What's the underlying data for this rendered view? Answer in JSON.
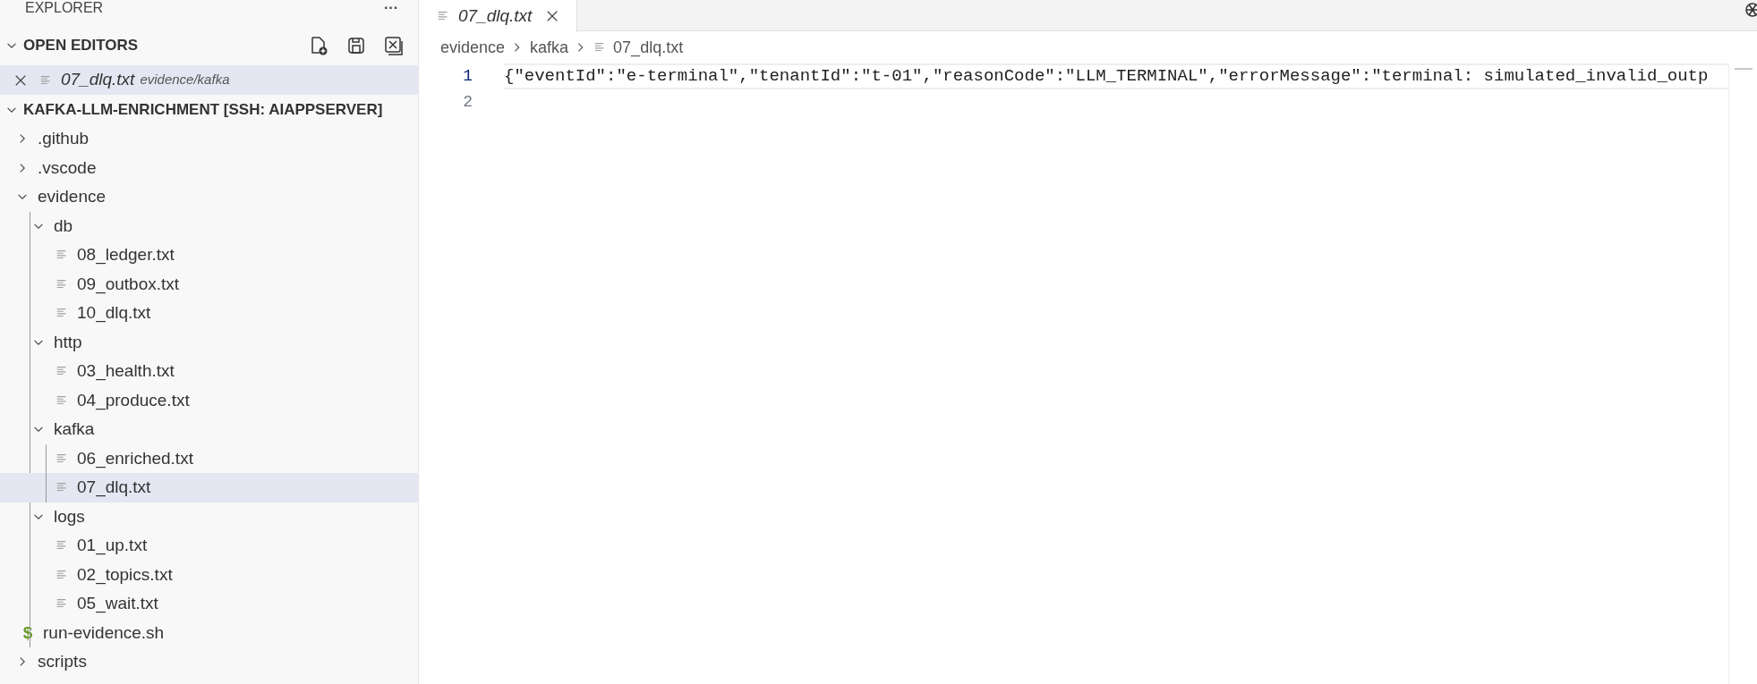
{
  "sidebar": {
    "title": "EXPLORER",
    "more": "···",
    "open_editors": {
      "title": "OPEN EDITORS",
      "expanded": true,
      "items": [
        {
          "name": "07_dlq.txt",
          "path": "evidence/kafka",
          "selected": true
        }
      ]
    },
    "project": {
      "title": "KAFKA-LLM-ENRICHMENT [SSH: AIAPPSERVER]",
      "expanded": true,
      "children": [
        {
          "kind": "folder",
          "name": ".github",
          "expanded": false
        },
        {
          "kind": "folder",
          "name": ".vscode",
          "expanded": false
        },
        {
          "kind": "folder",
          "name": "evidence",
          "expanded": true,
          "children": [
            {
              "kind": "folder",
              "name": "db",
              "expanded": true,
              "children": [
                {
                  "kind": "file",
                  "name": "08_ledger.txt",
                  "selected": false
                },
                {
                  "kind": "file",
                  "name": "09_outbox.txt",
                  "selected": false
                },
                {
                  "kind": "file",
                  "name": "10_dlq.txt",
                  "selected": false
                }
              ]
            },
            {
              "kind": "folder",
              "name": "http",
              "expanded": true,
              "children": [
                {
                  "kind": "file",
                  "name": "03_health.txt",
                  "selected": false
                },
                {
                  "kind": "file",
                  "name": "04_produce.txt",
                  "selected": false
                }
              ]
            },
            {
              "kind": "folder",
              "name": "kafka",
              "expanded": true,
              "children": [
                {
                  "kind": "file",
                  "name": "06_enriched.txt",
                  "selected": false
                },
                {
                  "kind": "file",
                  "name": "07_dlq.txt",
                  "selected": true
                }
              ]
            },
            {
              "kind": "folder",
              "name": "logs",
              "expanded": true,
              "children": [
                {
                  "kind": "file",
                  "name": "01_up.txt",
                  "selected": false
                },
                {
                  "kind": "file",
                  "name": "02_topics.txt",
                  "selected": false
                },
                {
                  "kind": "file",
                  "name": "05_wait.txt",
                  "selected": false
                }
              ]
            },
            {
              "kind": "script",
              "icon": "$",
              "name": "run-evidence.sh",
              "selected": false
            }
          ]
        },
        {
          "kind": "folder",
          "name": "scripts",
          "expanded": false
        }
      ]
    }
  },
  "editor": {
    "tabs": [
      {
        "name": "07_dlq.txt",
        "selected": true
      }
    ],
    "breadcrumbs": [
      "evidence",
      "kafka",
      "07_dlq.txt"
    ],
    "lines": [
      {
        "number": "1",
        "text": "{\"eventId\":\"e-terminal\",\"tenantId\":\"t-01\",\"reasonCode\":\"LLM_TERMINAL\",\"errorMessage\":\"terminal: simulated_invalid_outp",
        "current": true
      },
      {
        "number": "2",
        "current": false
      }
    ]
  }
}
